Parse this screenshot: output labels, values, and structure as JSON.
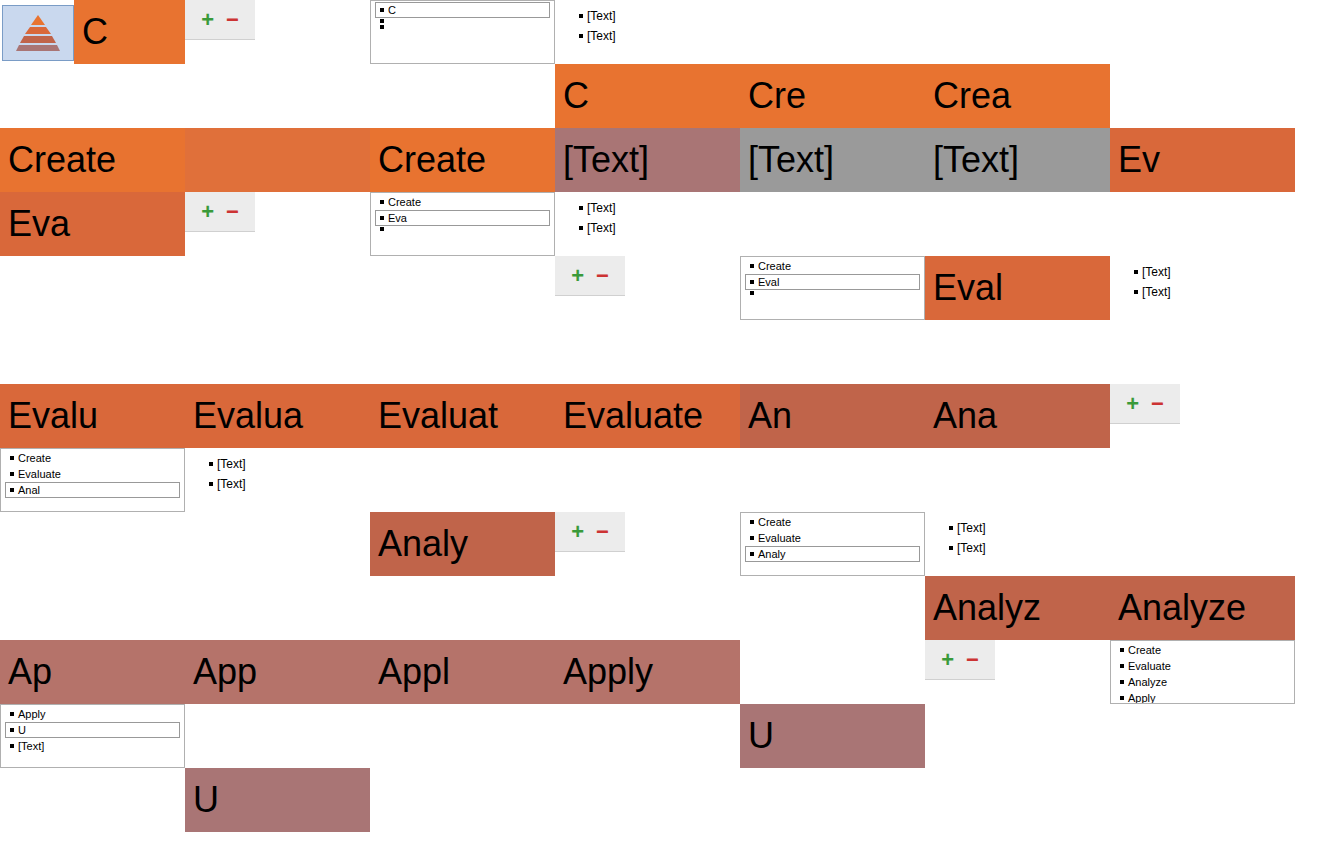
{
  "rows": [
    [
      {
        "kind": "icon-shape",
        "text": "C",
        "color": "#e87330"
      },
      {
        "kind": "toolbar",
        "plus": "+",
        "minus": "−"
      },
      {
        "kind": "pane",
        "items": [
          {
            "text": "C",
            "selected": true
          },
          {
            "text": "",
            "selected": false
          },
          {
            "text": "",
            "selected": false
          }
        ]
      },
      {
        "kind": "bullets",
        "items": [
          "[Text]",
          "[Text]"
        ]
      },
      {
        "kind": "blank"
      },
      {
        "kind": "blank"
      },
      {
        "kind": "blank"
      }
    ],
    [
      {
        "kind": "blank"
      },
      {
        "kind": "blank"
      },
      {
        "kind": "blank"
      },
      {
        "kind": "shape",
        "text": "C",
        "color": "#e87330"
      },
      {
        "kind": "shape",
        "text": "Cre",
        "color": "#e87330"
      },
      {
        "kind": "shape",
        "text": "Crea",
        "color": "#e87330"
      },
      {
        "kind": "blank"
      }
    ],
    [
      {
        "kind": "shape",
        "text": "Create",
        "color": "#e87330"
      },
      {
        "kind": "shape",
        "text": "",
        "color": "#e0703a"
      },
      {
        "kind": "shape",
        "text": "Create",
        "color": "#e87330"
      },
      {
        "kind": "shape",
        "text": "[Text]",
        "color": "#a97575"
      },
      {
        "kind": "shape",
        "text": "[Text]",
        "color": "#9a9a9a"
      },
      {
        "kind": "shape",
        "text": "[Text]",
        "color": "#9a9a9a"
      },
      {
        "kind": "shape",
        "text": "Ev",
        "color": "#d9683a"
      }
    ],
    [
      {
        "kind": "shape",
        "text": "Eva",
        "color": "#d9683a"
      },
      {
        "kind": "toolbar",
        "plus": "+",
        "minus": "−"
      },
      {
        "kind": "pane",
        "items": [
          {
            "text": "Create",
            "selected": false
          },
          {
            "text": "Eva",
            "selected": true
          },
          {
            "text": "",
            "selected": false
          }
        ]
      },
      {
        "kind": "bullets",
        "items": [
          "[Text]",
          "[Text]"
        ]
      },
      {
        "kind": "blank"
      },
      {
        "kind": "blank"
      },
      {
        "kind": "blank"
      }
    ],
    [
      {
        "kind": "blank"
      },
      {
        "kind": "blank"
      },
      {
        "kind": "blank"
      },
      {
        "kind": "toolbar",
        "plus": "+",
        "minus": "−"
      },
      {
        "kind": "pane",
        "items": [
          {
            "text": "Create",
            "selected": false
          },
          {
            "text": "Eval",
            "selected": true
          },
          {
            "text": "",
            "selected": false
          }
        ]
      },
      {
        "kind": "shape",
        "text": "Eval",
        "color": "#d9683a"
      },
      {
        "kind": "bullets",
        "items": [
          "[Text]",
          "[Text]"
        ]
      }
    ],
    [
      {
        "kind": "blank"
      },
      {
        "kind": "blank"
      },
      {
        "kind": "blank"
      },
      {
        "kind": "blank"
      },
      {
        "kind": "blank"
      },
      {
        "kind": "blank"
      },
      {
        "kind": "blank"
      }
    ],
    [
      {
        "kind": "shape",
        "text": "Evalu",
        "color": "#d9683a"
      },
      {
        "kind": "shape",
        "text": "Evalua",
        "color": "#d9683a"
      },
      {
        "kind": "shape",
        "text": "Evaluat",
        "color": "#d9683a"
      },
      {
        "kind": "shape",
        "text": "Evaluate",
        "color": "#d9683a"
      },
      {
        "kind": "shape",
        "text": "An",
        "color": "#c0644a"
      },
      {
        "kind": "shape",
        "text": "Ana",
        "color": "#c0644a"
      },
      {
        "kind": "toolbar",
        "plus": "+",
        "minus": "−"
      }
    ],
    [
      {
        "kind": "pane",
        "items": [
          {
            "text": "Create",
            "selected": false
          },
          {
            "text": "Evaluate",
            "selected": false
          },
          {
            "text": "Anal",
            "selected": true
          }
        ]
      },
      {
        "kind": "bullets",
        "items": [
          "[Text]",
          "[Text]"
        ]
      },
      {
        "kind": "blank"
      },
      {
        "kind": "blank"
      },
      {
        "kind": "blank"
      },
      {
        "kind": "blank"
      },
      {
        "kind": "blank"
      }
    ],
    [
      {
        "kind": "blank"
      },
      {
        "kind": "blank"
      },
      {
        "kind": "shape",
        "text": "Analy",
        "color": "#c0644a"
      },
      {
        "kind": "toolbar",
        "plus": "+",
        "minus": "−"
      },
      {
        "kind": "pane",
        "items": [
          {
            "text": "Create",
            "selected": false
          },
          {
            "text": "Evaluate",
            "selected": false
          },
          {
            "text": "Analy",
            "selected": true
          }
        ]
      },
      {
        "kind": "bullets",
        "items": [
          "[Text]",
          "[Text]"
        ]
      },
      {
        "kind": "blank"
      }
    ],
    [
      {
        "kind": "blank"
      },
      {
        "kind": "blank"
      },
      {
        "kind": "blank"
      },
      {
        "kind": "blank"
      },
      {
        "kind": "blank"
      },
      {
        "kind": "shape",
        "text": "Analyz",
        "color": "#c0644a"
      },
      {
        "kind": "shape",
        "text": "Analyze",
        "color": "#c0644a"
      }
    ],
    [
      {
        "kind": "shape",
        "text": "Ap",
        "color": "#b5736a"
      },
      {
        "kind": "shape",
        "text": "App",
        "color": "#b5736a"
      },
      {
        "kind": "shape",
        "text": "Appl",
        "color": "#b5736a"
      },
      {
        "kind": "shape",
        "text": "Apply",
        "color": "#b5736a"
      },
      {
        "kind": "blank"
      },
      {
        "kind": "toolbar",
        "plus": "+",
        "minus": "−"
      },
      {
        "kind": "pane",
        "items": [
          {
            "text": "Create",
            "selected": false
          },
          {
            "text": "Evaluate",
            "selected": false
          },
          {
            "text": "Analyze",
            "selected": false
          },
          {
            "text": "Apply",
            "selected": false
          }
        ]
      }
    ],
    [
      {
        "kind": "pane",
        "items": [
          {
            "text": "Apply",
            "selected": false
          },
          {
            "text": "U",
            "selected": true
          },
          {
            "text": "[Text]",
            "selected": false
          }
        ]
      },
      {
        "kind": "blank"
      },
      {
        "kind": "blank"
      },
      {
        "kind": "blank"
      },
      {
        "kind": "shape",
        "text": "U",
        "color": "#a97575"
      },
      {
        "kind": "blank"
      },
      {
        "kind": "blank"
      }
    ],
    [
      {
        "kind": "blank"
      },
      {
        "kind": "shape",
        "text": "U",
        "color": "#a97575"
      },
      {
        "kind": "blank"
      },
      {
        "kind": "blank"
      },
      {
        "kind": "blank"
      },
      {
        "kind": "blank"
      },
      {
        "kind": "blank"
      }
    ]
  ]
}
